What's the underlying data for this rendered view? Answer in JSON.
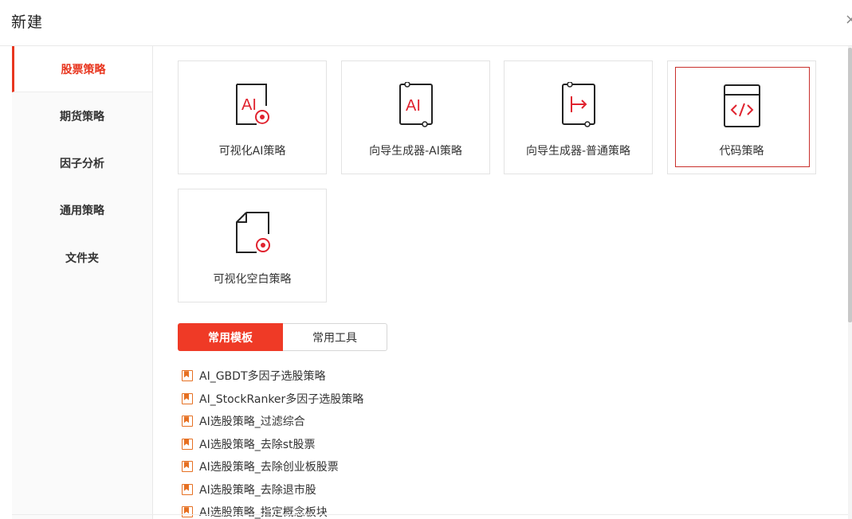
{
  "dialog": {
    "title": "新建",
    "close_glyph": "×"
  },
  "sidebar": {
    "items": [
      {
        "label": "股票策略",
        "active": true
      },
      {
        "label": "期货策略",
        "active": false
      },
      {
        "label": "因子分析",
        "active": false
      },
      {
        "label": "通用策略",
        "active": false
      },
      {
        "label": "文件夹",
        "active": false
      }
    ]
  },
  "cards": [
    {
      "label": "可视化AI策略",
      "icon": "visual-ai-icon"
    },
    {
      "label": "向导生成器-AI策略",
      "icon": "wizard-ai-icon"
    },
    {
      "label": "向导生成器-普通策略",
      "icon": "wizard-normal-icon"
    },
    {
      "label": "代码策略",
      "icon": "code-icon",
      "selected": true
    },
    {
      "label": "可视化空白策略",
      "icon": "blank-doc-icon"
    }
  ],
  "tabs": {
    "templates": "常用模板",
    "tools": "常用工具",
    "active": "templates"
  },
  "templates": [
    "AI_GBDT多因子选股策略",
    "AI_StockRanker多因子选股策略",
    "AI选股策略_过滤综合",
    "AI选股策略_去除st股票",
    "AI选股策略_去除创业板股票",
    "AI选股策略_去除退市股",
    "AI选股策略_指定概念板块"
  ],
  "colors": {
    "accent": "#ef3a26",
    "icon_red": "#e0232f",
    "bookmark_orange": "#e67022"
  }
}
